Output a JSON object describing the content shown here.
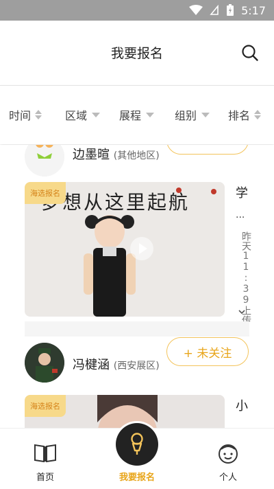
{
  "status_bar": {
    "time": "5:17"
  },
  "header": {
    "title": "我要报名"
  },
  "filters": [
    {
      "label": "时间",
      "kind": "sort"
    },
    {
      "label": "区域",
      "kind": "dropdown"
    },
    {
      "label": "展程",
      "kind": "dropdown"
    },
    {
      "label": "组别",
      "kind": "dropdown"
    },
    {
      "label": "排名",
      "kind": "sort"
    }
  ],
  "entries": [
    {
      "name": "边墨暄",
      "region": "(其他地区)",
      "side_title": "学",
      "side_dots": "...",
      "upload_time": "昨天11:39上传",
      "tag": "海选报名",
      "video_caption": "梦想从这里起航"
    },
    {
      "name": "冯楗涵",
      "region": "(西安展区)",
      "follow_label": "+ 未关注",
      "side_title": "小",
      "tag": "海选报名"
    }
  ],
  "tabbar": {
    "home_label": "首页",
    "signup_label": "我要报名",
    "profile_label": "个人"
  },
  "colors": {
    "accent": "#e8a51a",
    "tag_bg": "#f7d98a",
    "statusbar": "#9e9e9e"
  }
}
